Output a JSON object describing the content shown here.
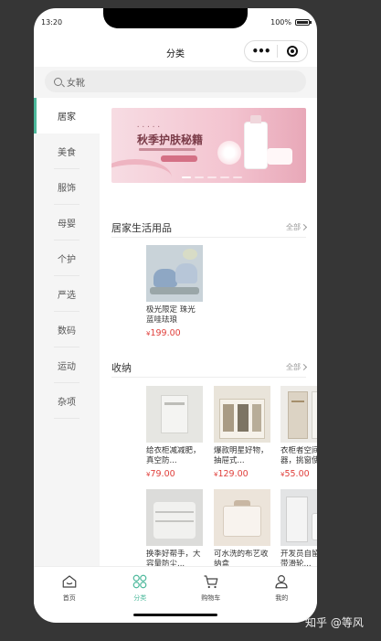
{
  "status": {
    "time": "13:20",
    "battery": "100%"
  },
  "nav": {
    "title": "分类"
  },
  "search": {
    "placeholder": "女靴"
  },
  "sidebar": {
    "items": [
      {
        "label": "居家",
        "active": true
      },
      {
        "label": "美食"
      },
      {
        "label": "服饰"
      },
      {
        "label": "母婴"
      },
      {
        "label": "个护"
      },
      {
        "label": "严选"
      },
      {
        "label": "数码"
      },
      {
        "label": "运动"
      },
      {
        "label": "杂项"
      }
    ]
  },
  "banner": {
    "title": "秋季护肤秘籍"
  },
  "sections": [
    {
      "name": "居家生活用品",
      "all": "全部",
      "products": [
        {
          "name": "极光限定 珠光蓝哇珐琅",
          "currency": "¥",
          "price": "199.00"
        }
      ]
    },
    {
      "name": "收纳",
      "all": "全部",
      "products": [
        {
          "name": "给衣柜减减肥，真空防...",
          "currency": "¥",
          "price": "79.00"
        },
        {
          "name": "爆款明星好物，抽屉式...",
          "currency": "¥",
          "price": "129.00"
        },
        {
          "name": "衣柜者空间神器，挑窗使...",
          "currency": "¥",
          "price": "55.00"
        },
        {
          "name": "换季好帮手，大容量防尘...",
          "currency": "¥",
          "price": ""
        },
        {
          "name": "可水洗的布艺收纳盒",
          "currency": "¥",
          "price": ""
        },
        {
          "name": "开发员自留款，带滑轮...",
          "currency": "¥",
          "price": ""
        }
      ]
    }
  ],
  "tabbar": [
    {
      "label": "首页",
      "icon": "home-icon"
    },
    {
      "label": "分类",
      "icon": "category-icon",
      "active": true
    },
    {
      "label": "购物车",
      "icon": "cart-icon"
    },
    {
      "label": "我的",
      "icon": "user-icon"
    }
  ],
  "watermark": "知乎 @等风",
  "colors": {
    "accent": "#4cb89b",
    "price": "#e0403c",
    "background": "#363636"
  }
}
